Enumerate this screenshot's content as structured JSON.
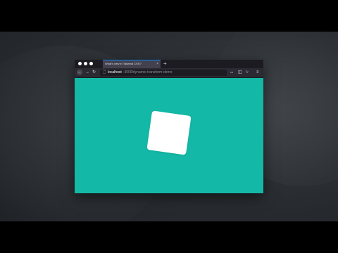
{
  "browser": {
    "tab_title": "What's new in Tailwind CSS?",
    "tab_close": "×",
    "new_tab": "+",
    "url_host": "localhost",
    "url_path": ":3000/dynamic-transform-demo",
    "icons": {
      "back": "←",
      "forward": "→",
      "reload": "↻",
      "url_page": "🗋",
      "more": "•••",
      "pocket": "◫",
      "bookmark": "☆",
      "menu": "≡"
    }
  },
  "colors": {
    "content_bg": "#14b8a6",
    "square": "#ffffff",
    "window_chrome": "#2b2a33"
  }
}
